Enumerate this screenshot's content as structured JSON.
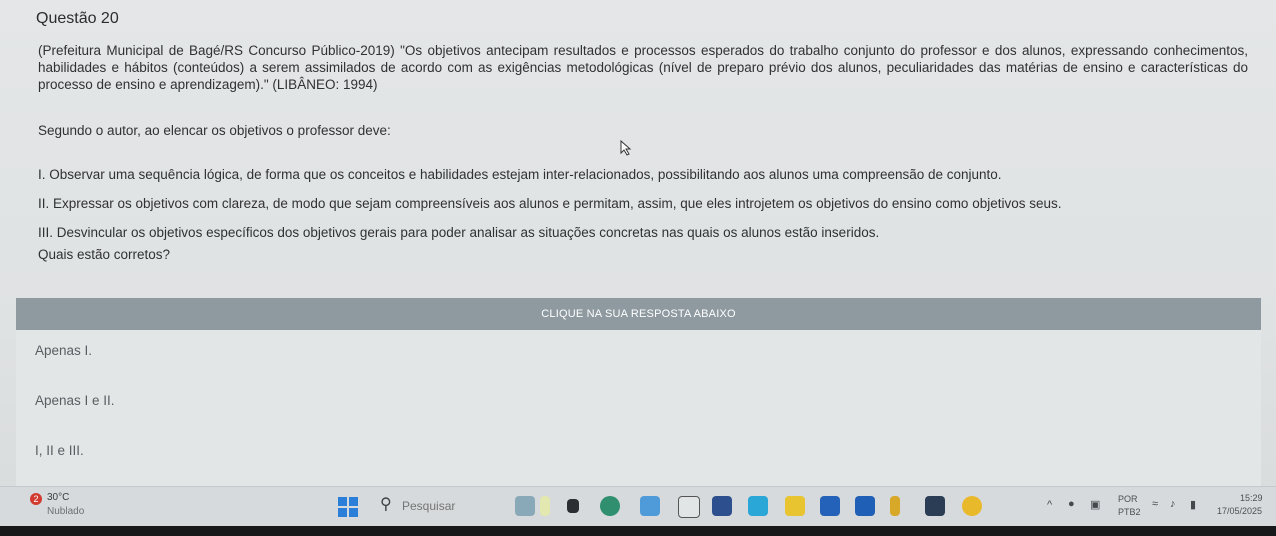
{
  "question": {
    "title": "Questão 20",
    "paragraphs": [
      "(Prefeitura Municipal de Bagé/RS Concurso Público-2019) \"Os objetivos antecipam resultados e processos esperados do trabalho conjunto do professor e dos alunos, expressando conhecimentos, habilidades e hábitos (conteúdos) a serem assimilados de acordo com as exigências metodológicas (nível de preparo prévio dos alunos, peculiaridades das matérias de ensino e características do processo de ensino e aprendizagem).\" (LIBÂNEO: 1994)",
      "Segundo o autor, ao elencar os objetivos o professor deve:",
      "I. Observar uma sequência lógica, de forma que os conceitos e habilidades estejam inter-relacionados, possibilitando aos alunos uma compreensão de conjunto.",
      "II. Expressar os objetivos com clareza, de modo que sejam compreensíveis aos alunos e permitam, assim, que eles introjetem os objetivos do ensino como objetivos seus.",
      "III. Desvincular os objetivos específicos dos objetivos gerais para poder analisar as situações concretas nas quais os alunos estão inseridos.",
      "Quais estão corretos?"
    ]
  },
  "answer_header": "CLIQUE NA SUA RESPOSTA ABAIXO",
  "options": [
    "Apenas I.",
    "Apenas I e II.",
    "I, II e III."
  ],
  "taskbar": {
    "weather_badge": "2",
    "temperature": "30°C",
    "condition": "Nublado",
    "search_placeholder": "Pesquisar",
    "language": "POR",
    "layout": "PTB2",
    "time": "15:29",
    "date": "17/05/2025"
  }
}
